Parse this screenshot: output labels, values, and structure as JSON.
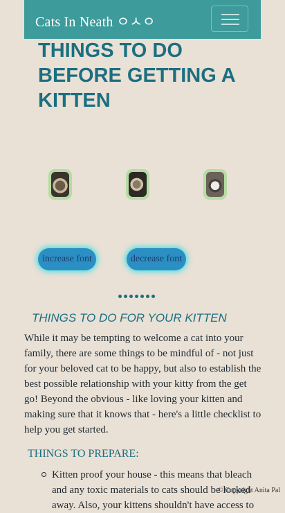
{
  "nav": {
    "brand": "Cats In Neath ㅇㅅㅇ"
  },
  "header": {
    "title": "THINGS TO DO BEFORE GETTING A KITTEN"
  },
  "controls": {
    "increase_label": "increase font",
    "decrease_label": "decrease font"
  },
  "section": {
    "subtitle": "THINGS TO DO FOR YOUR KITTEN",
    "intro": "While it may be tempting to welcome a cat into your family, there are some things to be mindful of - not just for your beloved cat to be happy, but also to establish the best possible relationship with your kitty from the get go! Beyond the obvious - like loving your kitten and making sure that it knows that - here's a little checklist to help you get started.",
    "prep_heading": "THINGS TO PREPARE:",
    "prep_items": [
      "Kitten proof your house - this means that bleach and any toxic materials to cats should be locked away. Also, your kittens shouldn't have access to"
    ]
  },
  "footer": {
    "copyright": "© Copyright Anita Pal"
  },
  "icons": {
    "menu": "hamburger-menu-icon",
    "carousel": "carousel-indicator-dots"
  },
  "colors": {
    "navbar": "#3d9b9b",
    "title": "#1b6f80",
    "background": "#e9e0d6",
    "button": "#2b8fc4",
    "button_glow": "#3fe0e6"
  }
}
